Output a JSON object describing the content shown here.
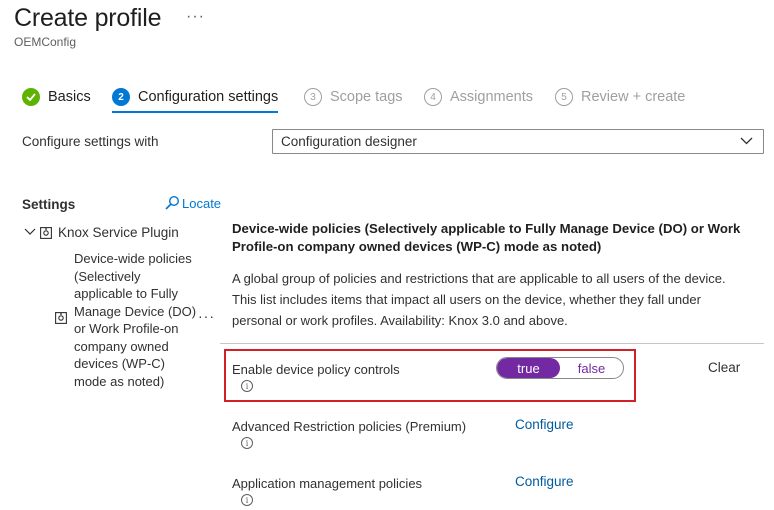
{
  "header": {
    "title": "Create profile",
    "more": "···",
    "subtitle": "OEMConfig"
  },
  "steps": [
    {
      "number": "✓",
      "label": "Basics",
      "state": "done"
    },
    {
      "number": "2",
      "label": "Configuration settings",
      "state": "current"
    },
    {
      "number": "3",
      "label": "Scope tags",
      "state": "todo"
    },
    {
      "number": "4",
      "label": "Assignments",
      "state": "todo"
    },
    {
      "number": "5",
      "label": "Review + create",
      "state": "todo"
    }
  ],
  "configure_with": {
    "label": "Configure settings with",
    "selected": "Configuration designer"
  },
  "settings_panel": {
    "header": "Settings",
    "locate": "Locate",
    "tree_root": "Knox Service Plugin",
    "tree_child": "Device-wide policies (Selectively applicable to Fully Manage Device (DO) or Work Profile-on company owned devices (WP-C) mode as noted)",
    "more": "···"
  },
  "section": {
    "title": "Device-wide policies (Selectively applicable to Fully Manage Device (DO) or Work Profile-on company owned devices (WP-C) mode as noted)",
    "description": "A global group of policies and restrictions that are applicable to all users of the device. This list includes items that impact all users on the device, whether they fall under personal or work profiles. Availability: Knox 3.0 and above."
  },
  "rows": {
    "enable": {
      "label": "Enable device policy controls",
      "true_label": "true",
      "false_label": "false",
      "clear": "Clear"
    },
    "advanced": {
      "label": "Advanced Restriction policies (Premium)",
      "action": "Configure"
    },
    "appmgmt": {
      "label": "Application management policies",
      "action": "Configure"
    }
  },
  "icons": {
    "info": "i"
  },
  "colors": {
    "accent": "#0078d4",
    "toggle_on": "#7229a2",
    "highlight": "#d0202a",
    "done": "#5db300"
  }
}
